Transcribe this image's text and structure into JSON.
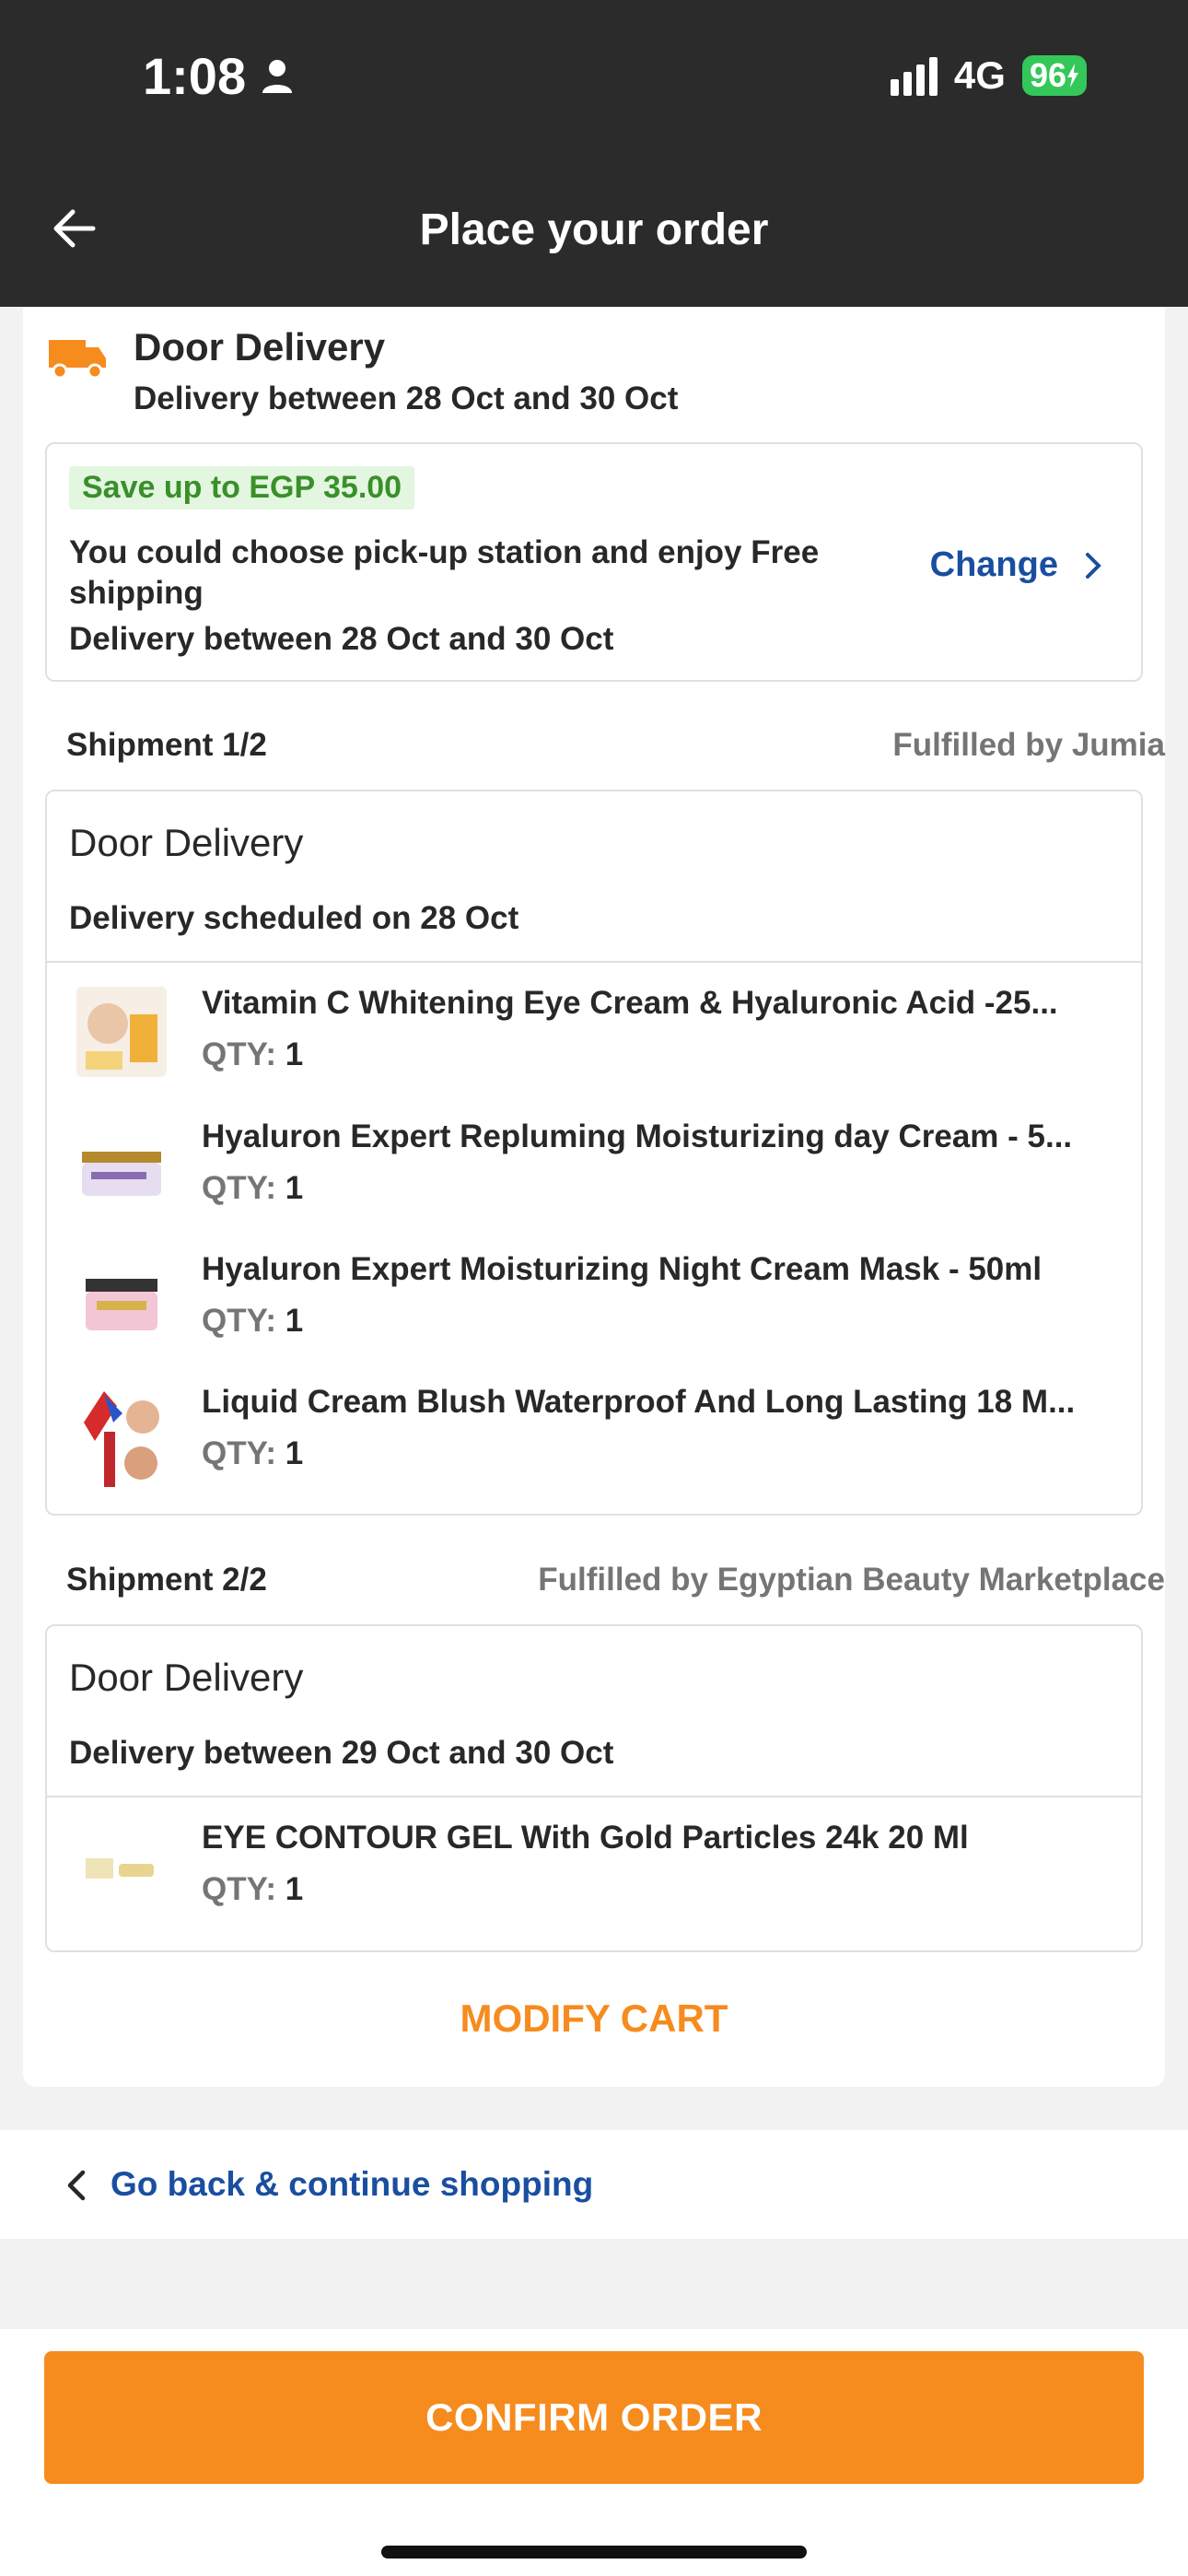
{
  "status_bar": {
    "time": "1:08",
    "network": "4G",
    "battery": "96"
  },
  "header": {
    "title": "Place your order"
  },
  "delivery": {
    "title": "Door Delivery",
    "subtitle": "Delivery between 28 Oct and 30 Oct"
  },
  "promo": {
    "tag": "Save up to EGP 35.00",
    "text": "You could choose pick-up station and enjoy Free shipping",
    "date": "Delivery between 28 Oct and 30 Oct",
    "change_label": "Change"
  },
  "shipments": [
    {
      "label": "Shipment 1/2",
      "fulfilled": "Fulfilled by Jumia",
      "box_title": "Door Delivery",
      "schedule": "Delivery scheduled on 28 Oct",
      "items": [
        {
          "name": "Vitamin C Whitening Eye Cream & Hyaluronic Acid  -25...",
          "qty_label": "QTY:",
          "qty": "1"
        },
        {
          "name": "Hyaluron Expert Repluming Moisturizing day Cream - 5...",
          "qty_label": "QTY:",
          "qty": "1"
        },
        {
          "name": "Hyaluron Expert Moisturizing Night Cream Mask - 50ml",
          "qty_label": "QTY:",
          "qty": "1"
        },
        {
          "name": "Liquid Cream Blush Waterproof And Long Lasting 18 M...",
          "qty_label": "QTY:",
          "qty": "1"
        }
      ]
    },
    {
      "label": "Shipment 2/2",
      "fulfilled": "Fulfilled by Egyptian Beauty Marketplace",
      "box_title": "Door Delivery",
      "schedule": "Delivery between 29 Oct and 30 Oct",
      "items": [
        {
          "name": "EYE CONTOUR GEL With Gold Particles 24k 20 Ml",
          "qty_label": "QTY:",
          "qty": "1"
        }
      ]
    }
  ],
  "modify_cart_label": "MODIFY CART",
  "go_back_label": "Go back & continue shopping",
  "confirm_label": "CONFIRM ORDER",
  "colors": {
    "accent": "#f68b1e",
    "link": "#1a4ea0",
    "header_bg": "#2b2b2b",
    "promo_green": "#3a8f2a"
  }
}
